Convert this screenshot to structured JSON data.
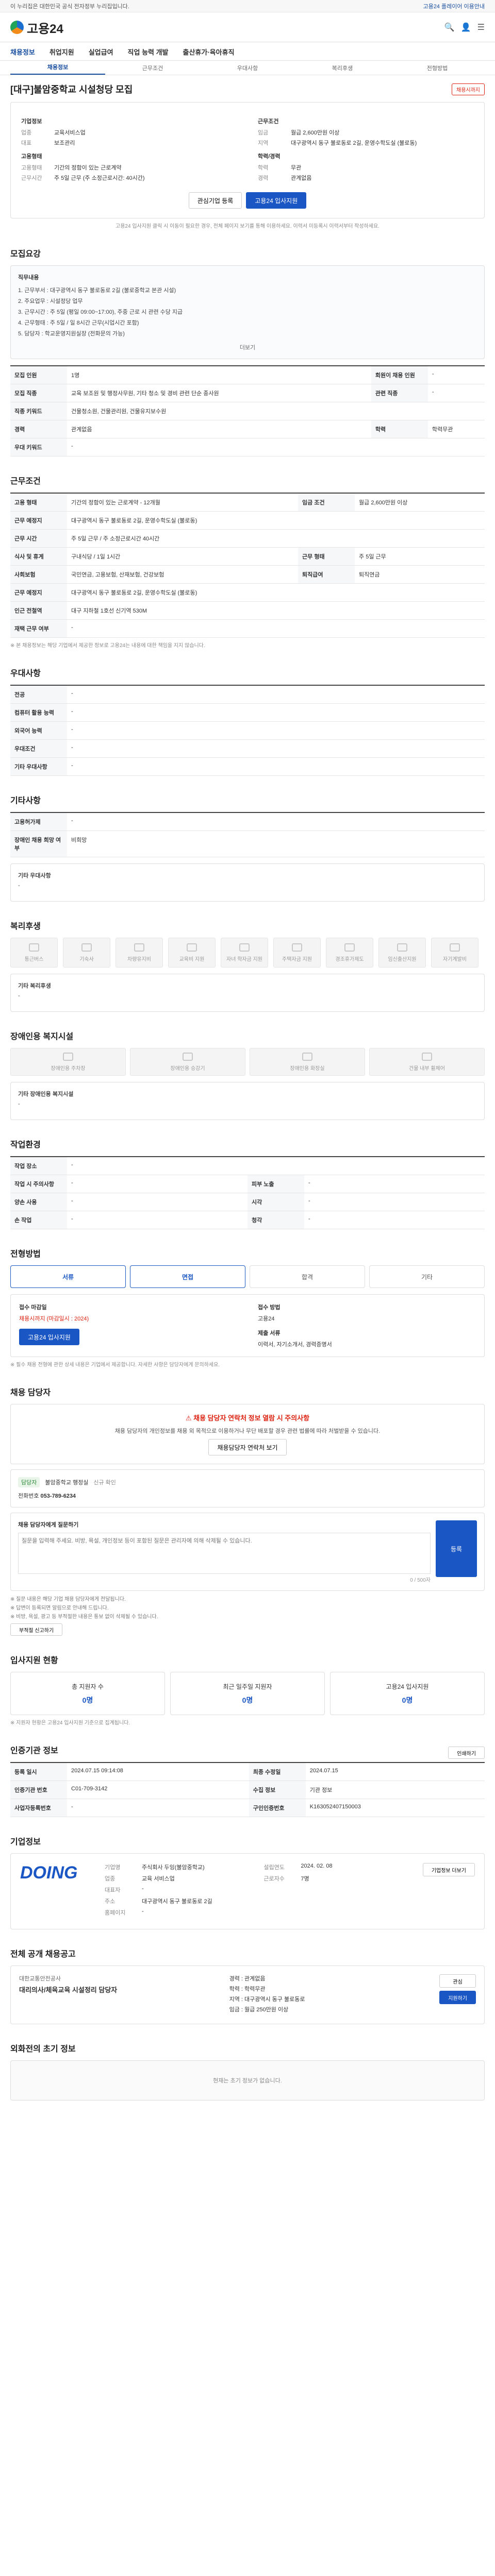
{
  "topbar": {
    "left": "이 누리집은 대한민국 공식 전자정부 누리집입니다.",
    "right": "고용24 플레이어 이용안내"
  },
  "header": {
    "logo": "고용24"
  },
  "gnb": [
    "채용정보",
    "취업지원",
    "실업급여",
    "직업 능력 개발",
    "출산휴가·육아휴직"
  ],
  "subtabs": [
    "채용정보",
    "근무조건",
    "우대사항",
    "복리후생",
    "전형방법"
  ],
  "title": "[대구]불암중학교 시설청당 모집",
  "status": "채용시까지",
  "summary": {
    "company_title": "기업정보",
    "company_rows": [
      [
        "업종",
        "교육서비스업"
      ],
      [
        "대표",
        "보조관리"
      ]
    ],
    "cond_title": "근무조건",
    "cond_rows": [
      [
        "임금",
        "월급 2,600만원 이상"
      ],
      [
        "지역",
        "대구광역시 동구 불로동로 2길, 운영수학도실 (불로동)"
      ]
    ],
    "app_title": "고용형태",
    "app_rows": [
      [
        "고용형태",
        "기간의 정함이 있는 근로계약"
      ],
      [
        "근무시간",
        "주 5일 근무 (주 소정근로시간: 40시간)"
      ]
    ],
    "edu_title": "학력/경력",
    "edu_rows": [
      [
        "학력",
        "무관"
      ],
      [
        "경력",
        "관계없음"
      ]
    ]
  },
  "actions": {
    "interest": "관심기업 등록",
    "apply": "고용24 입사지원",
    "note": "고용24 입사지원 클릭 시 이동이 필요한 경우, 전체 페이지 보기를 통해 이용하세요. 이력서 미등록시 이력서부터 작성하세요."
  },
  "job": {
    "title": "모집요강",
    "desc_label": "직무내용",
    "desc": [
      "1. 근무부서 : 대구광역시 동구 불로동로 2길 (불로중학교 본관 시설)",
      "2. 주요업무 : 시설정당 업무",
      "3. 근무시간 : 주 5일 (평일 09:00~17:00), 주중 근로 시 관련 수당 지급",
      "4. 근무형태 : 주 5일 / 일 8시간 근무(시업시간 포함)",
      "5. 담당자 : 학교운영지원실장 (전화문의 가능)"
    ],
    "more": "더보기",
    "rows": [
      [
        "모집 인원",
        "1명",
        "회원이 채용 인원",
        "-"
      ],
      [
        "모집 직종",
        "교육 보조원 및 행정사무원, 기타 청소 및 경비 관련 단순 종사원",
        "관련 직종",
        "-"
      ],
      [
        "직종 키워드",
        "건물청소원, 건물관리원, 건물유지보수원",
        "",
        ""
      ],
      [
        "경력",
        "관계없음",
        "학력",
        "학력무관"
      ],
      [
        "우대 키워드",
        "-",
        "",
        ""
      ]
    ]
  },
  "cond": {
    "title": "근무조건",
    "rows": [
      [
        "고용 형태",
        "기간의 정함이 있는 근로계약 - 12개월",
        "임금 조건",
        "월급 2,600만원 이상"
      ],
      [
        "근무 예정지",
        "대구광역시 동구 불로동로 2길, 운영수학도실 (불로동)",
        "",
        ""
      ],
      [
        "근무 시간",
        "주 5일 근무 / 주 소정근로시간 40시간",
        "",
        ""
      ],
      [
        "식사 및 휴게",
        "구내식당 / 1일 1시간",
        "근무 형태",
        "주 5일 근무"
      ],
      [
        "사회보험",
        "국민연금, 고용보험, 산재보험, 건강보험",
        "퇴직급여",
        "퇴직연금"
      ],
      [
        "근무 예정지",
        "대구광역시 동구 불로동로 2길, 운영수학도실 (불로동)",
        "",
        ""
      ],
      [
        "인근 전철역",
        "대구 지하철 1호선 신기역 530M",
        "",
        ""
      ],
      [
        "재택 근무 여부",
        "-",
        "",
        ""
      ]
    ],
    "note": "※ 본 채용정보는 해당 기업에서 제공한 정보로 고용24는 내용에 대한 책임을 지지 않습니다."
  },
  "prefer": {
    "title": "우대사항",
    "rows": [
      [
        "전공",
        "-"
      ],
      [
        "컴퓨터 활용 능력",
        "-"
      ],
      [
        "외국어 능력",
        "-"
      ],
      [
        "우대조건",
        "-"
      ],
      [
        "기타 우대사항",
        "-"
      ]
    ]
  },
  "etc": {
    "title": "기타사항",
    "rows": [
      [
        "고용허가제",
        "-"
      ],
      [
        "장애인 채용 희망 여부",
        "비희망"
      ]
    ],
    "more_title": "기타 우대사항",
    "more_value": "-"
  },
  "welfare": {
    "title": "복리후생",
    "items": [
      "통근버스",
      "기숙사",
      "차량유지비",
      "교육비 지원",
      "자녀 학자금 지원",
      "주택자금 지원",
      "경조휴가제도",
      "임신출산지원",
      "자기계발비"
    ],
    "other_label": "기타 복리후생",
    "other_value": "-"
  },
  "disabled": {
    "title": "장애인용 복지시설",
    "items": [
      "장애인용 주차장",
      "장애인용 승강기",
      "장애인용 화장실",
      "건물 내부 휠체어"
    ],
    "other_label": "기타 장애인용 복지시설",
    "other_value": "-"
  },
  "workplace": {
    "title": "작업환경",
    "rows": [
      [
        "작업 장소",
        "-",
        "",
        ""
      ],
      [
        "작업 시 주의사항",
        "-",
        "피부 노출",
        "-"
      ],
      [
        "양손 사용",
        "-",
        "시각",
        "-"
      ],
      [
        "손 작업",
        "-",
        "청각",
        "-"
      ]
    ]
  },
  "process": {
    "title": "전형방법",
    "steps": [
      "서류",
      "면접",
      "합격",
      "기타"
    ],
    "deadline_label": "접수 마감일",
    "deadline": "채용시까지 (마감일시 : 2024)",
    "method_label": "접수 방법",
    "method": "고용24",
    "docs_label": "제출 서류",
    "docs": "이력서, 자기소개서, 경력증명서",
    "apply": "고용24 입사지원",
    "note": "※ 필수 채용 전형에 관한 상세 내용은 기업에서 제공합니다. 자세한 사항은 담당자에게 문의하세요."
  },
  "contact": {
    "title": "채용 담당자",
    "alert": "채용 담당자 연락처 정보 열람 시 주의사항",
    "alert_desc": "채용 담당자의 개인정보를 채용 외 목적으로 이용하거나 무단 배포할 경우 관련 법률에 따라 처벌받을 수 있습니다.",
    "view_btn": "채용담당자 연락처 보기",
    "name_label": "담당자",
    "name": "신규 확인",
    "dept": "불암중학교 행정실",
    "phone_label": "전화번호",
    "phone": "053-789-6234",
    "qa_title": "채용 담당자에게 질문하기",
    "qa_hint": "질문을 입력해 주세요. 비방, 욕설, 개인정보 등이 포함된 질문은 관리자에 의해 삭제될 수 있습니다.",
    "qa_counter": "0 / 500자",
    "qa_submit": "등록",
    "notes": [
      "※ 질문 내용은 해당 기업 채용 담당자에게 전달됩니다.",
      "※ 답변이 등록되면 알림으로 안내해 드립니다.",
      "※ 비방, 욕설, 광고 등 부적절한 내용은 통보 없이 삭제될 수 있습니다."
    ],
    "report": "부적절 신고하기"
  },
  "stats": {
    "title": "입사지원 현황",
    "items": [
      [
        "총 지원자 수",
        "0명"
      ],
      [
        "최근 일주일 지원자",
        "0명"
      ],
      [
        "고용24 입사지원",
        "0명"
      ]
    ],
    "note": "※ 지원자 현황은 고용24 입사지원 기준으로 집계됩니다."
  },
  "org": {
    "title": "인증기관 정보",
    "rows": [
      [
        "등록 일시",
        "2024.07.15 09:14:08",
        "최종 수정일",
        "2024.07.15"
      ],
      [
        "인증기관 번호",
        "C01-709-3142",
        "수집 정보",
        "기관 정보"
      ],
      [
        "사업자등록번호",
        "-",
        "구인인증번호",
        "K163052407150003"
      ]
    ],
    "print": "인쇄하기"
  },
  "company": {
    "title": "기업정보",
    "name": "DOING",
    "rows": [
      [
        "기업명",
        "주식회사 두잉(불암중학교)"
      ],
      [
        "업종",
        "교육 서비스업"
      ],
      [
        "대표자",
        "-"
      ],
      [
        "주소",
        "대구광역시 동구 불로동로 2길"
      ],
      [
        "홈페이지",
        "-"
      ]
    ],
    "side": [
      [
        "설립연도",
        "2024. 02. 08"
      ],
      [
        "근로자수",
        "7명"
      ]
    ],
    "detail": "기업정보 더보기"
  },
  "similar": {
    "title": "전체 공개 채용공고",
    "company": "대한교통안전공사",
    "job": "대리의사/체육교육 시설정리 담당자",
    "bullets": [
      "경력 : 관계없음",
      "학력 : 학력무관",
      "지역 : 대구광역시 동구 불로동로",
      "임금 : 월급 250만원 이상"
    ],
    "btns": [
      "관심",
      "지원하기"
    ]
  },
  "bottom": {
    "title": "외화전의 초기 정보",
    "note": "현재는 초기 정보가 없습니다."
  }
}
